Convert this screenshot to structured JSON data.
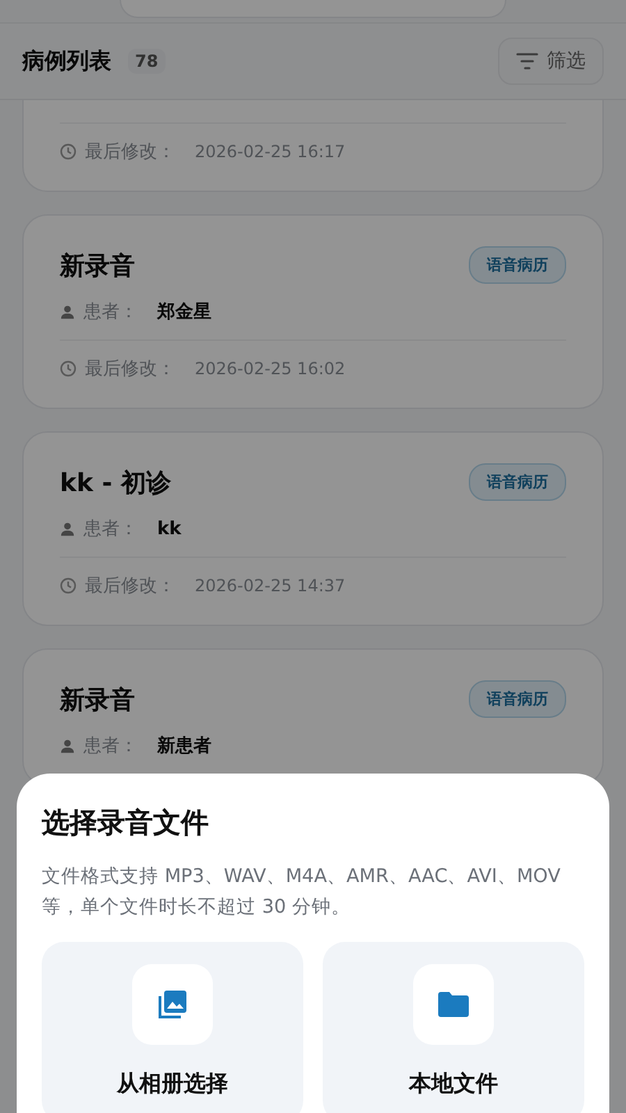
{
  "header": {
    "title": "病例列表",
    "count": "78",
    "filter_label": "筛选"
  },
  "cards": [
    {
      "modified_label": "最后修改：",
      "modified": "2026-02-25 16:17"
    },
    {
      "title": "新录音",
      "tag": "语音病历",
      "patient_label": "患者：",
      "patient": "郑金星",
      "modified_label": "最后修改：",
      "modified": "2026-02-25 16:02"
    },
    {
      "title": "kk - 初诊",
      "tag": "语音病历",
      "patient_label": "患者：",
      "patient": "kk",
      "modified_label": "最后修改：",
      "modified": "2026-02-25 14:37"
    },
    {
      "title": "新录音",
      "tag": "语音病历",
      "patient_label": "患者：",
      "patient": "新患者"
    }
  ],
  "sheet": {
    "title": "选择录音文件",
    "description": "文件格式支持 MP3、WAV、M4A、AMR、AAC、AVI、MOV 等，单个文件时长不超过 30 分钟。",
    "options": [
      {
        "kind": "album",
        "label": "从相册选择"
      },
      {
        "kind": "folder",
        "label": "本地文件"
      }
    ]
  }
}
